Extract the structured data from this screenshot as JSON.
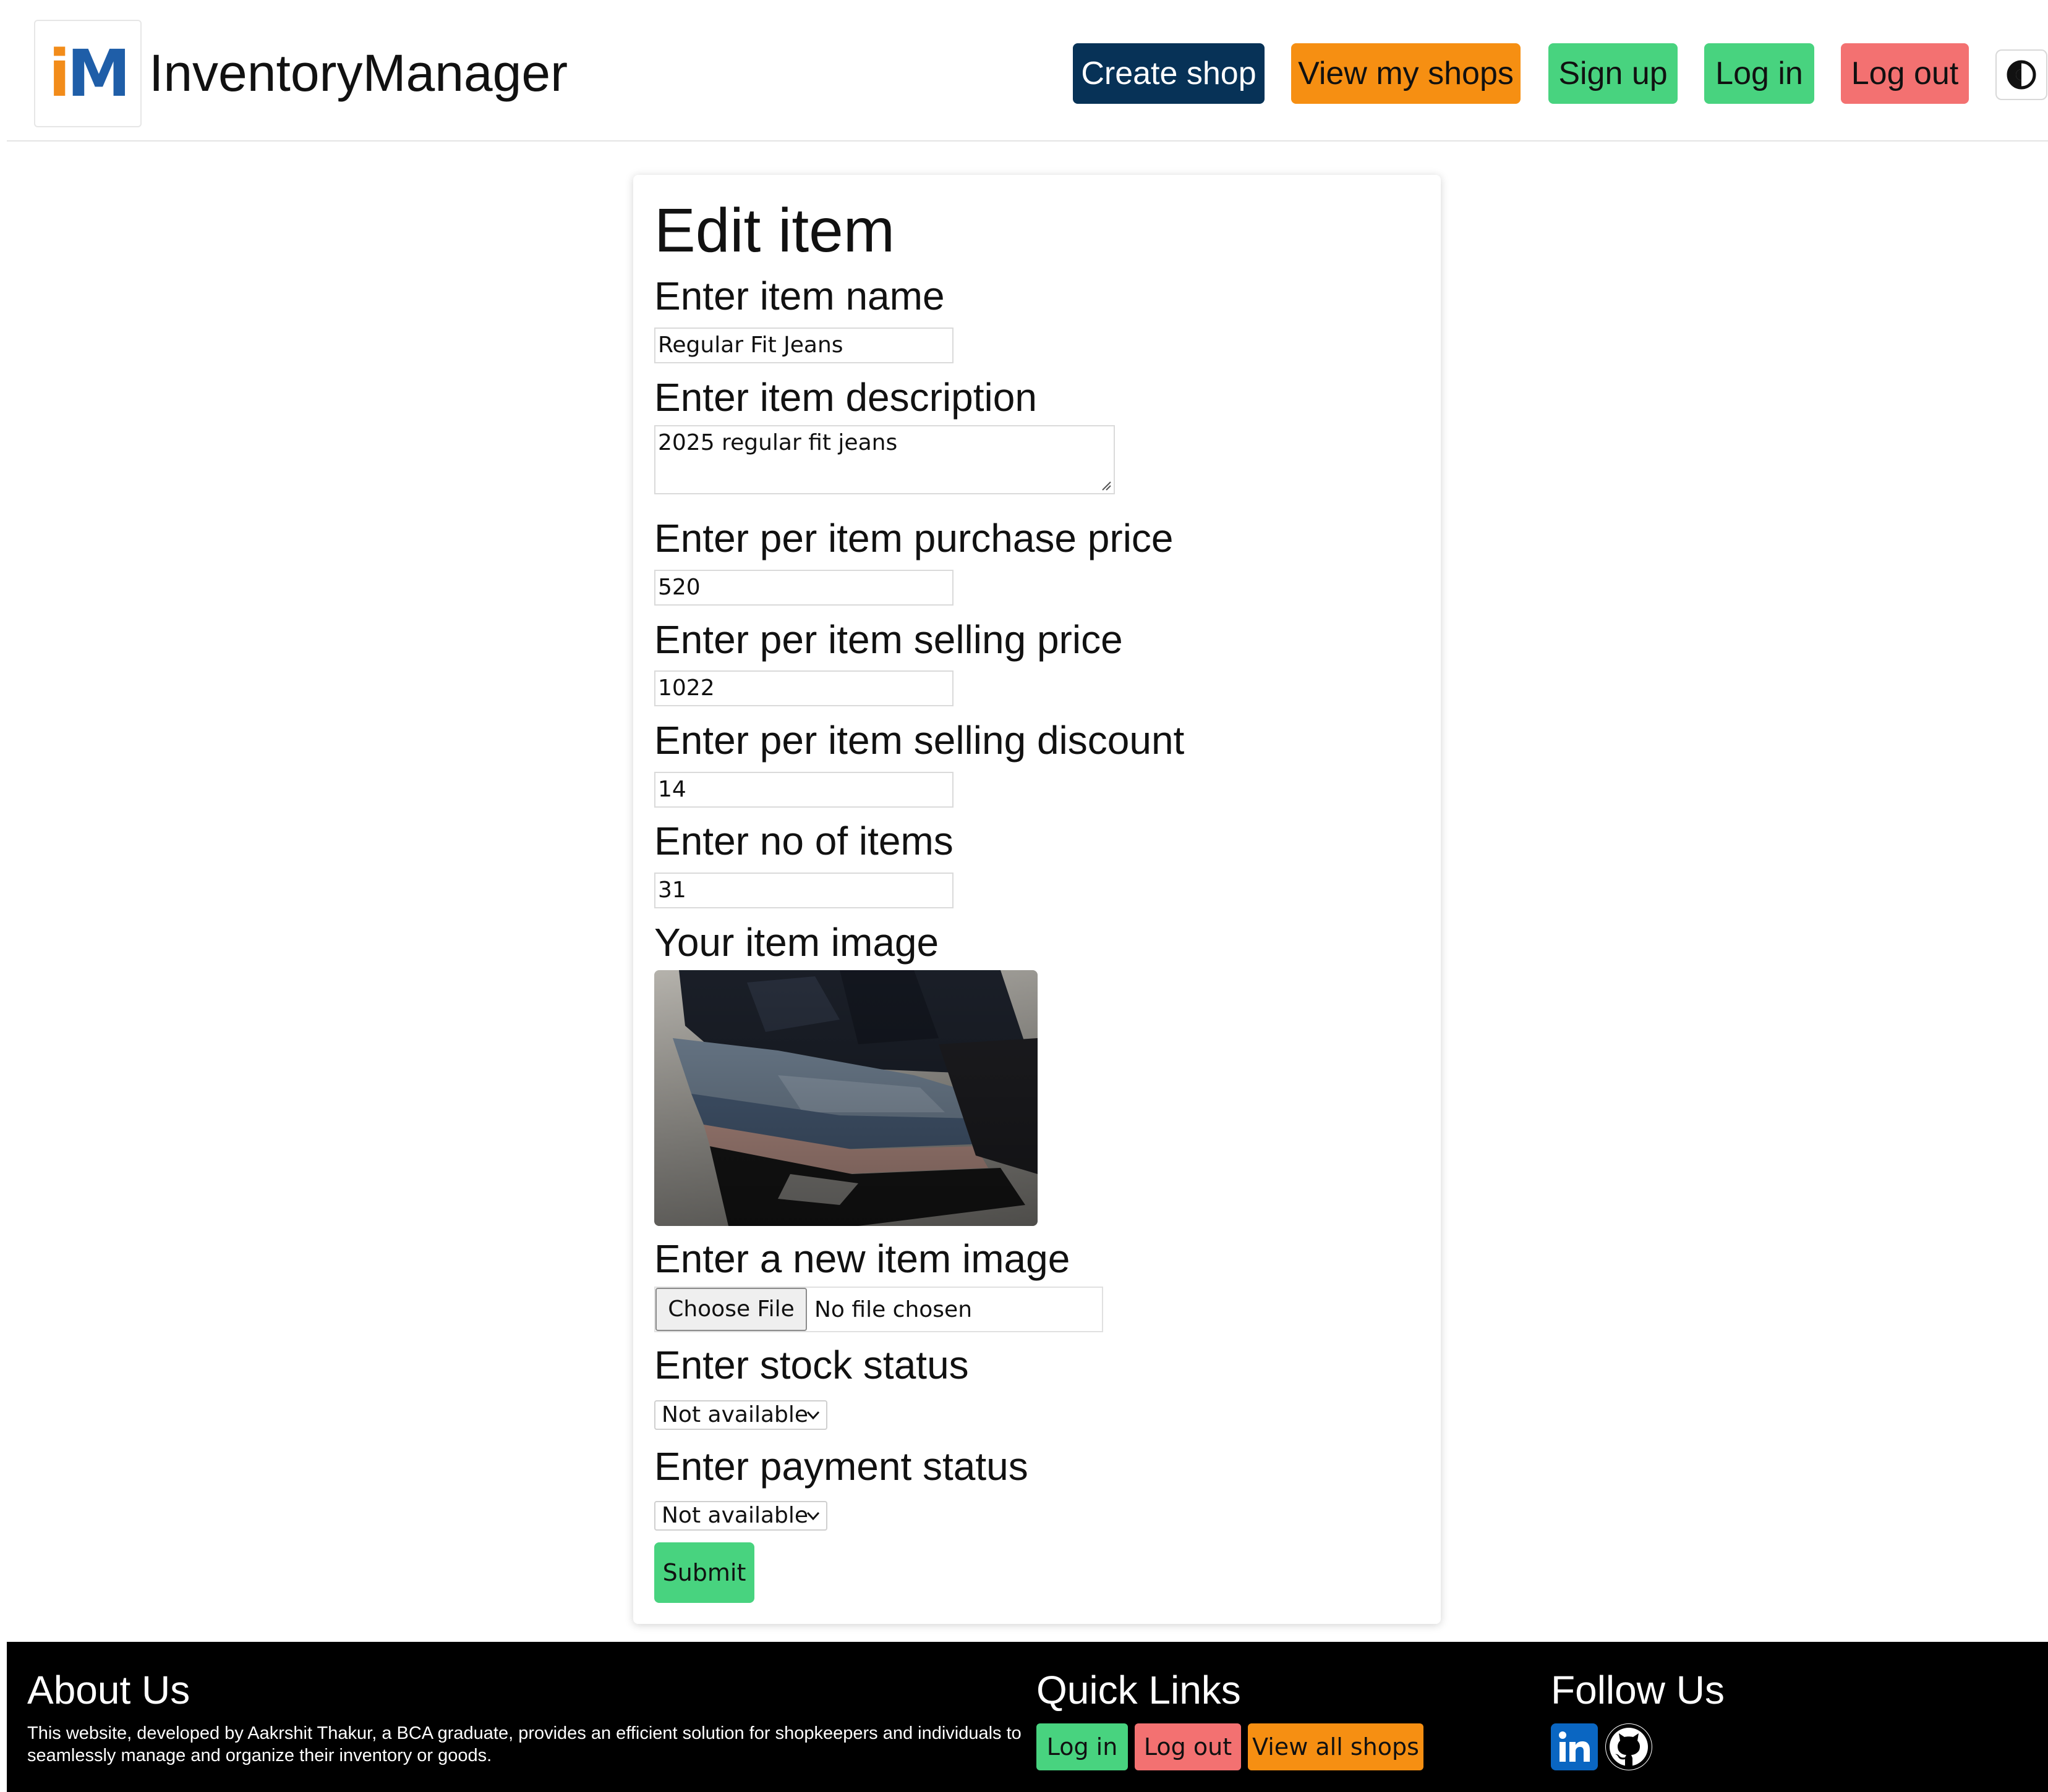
{
  "brand": {
    "logo_i": "i",
    "logo_m": "M",
    "name": "InventoryManager"
  },
  "nav": {
    "create_shop": "Create shop",
    "view_my_shops": "View my shops",
    "sign_up": "Sign up",
    "log_in": "Log in",
    "log_out": "Log out",
    "theme_icon": "contrast-icon"
  },
  "form": {
    "title": "Edit item",
    "name_label": "Enter item name",
    "name_value": "Regular Fit Jeans",
    "description_label": "Enter item description",
    "description_value": "2025 regular fit jeans",
    "purchase_price_label": "Enter per item purchase price",
    "purchase_price_value": "520",
    "selling_price_label": "Enter per item selling price",
    "selling_price_value": "1022",
    "discount_label": "Enter per item selling discount",
    "discount_value": "14",
    "quantity_label": "Enter no of items",
    "quantity_value": "31",
    "image_label": "Your item image",
    "new_image_label": "Enter a new item image",
    "choose_file": "Choose File",
    "no_file": "No file chosen",
    "stock_label": "Enter stock status",
    "stock_value": "Not available",
    "payment_label": "Enter payment status",
    "payment_value": "Not available",
    "submit": "Submit"
  },
  "footer": {
    "about_title": "About Us",
    "about_text": "This website, developed by Aakrshit Thakur, a BCA graduate, provides an efficient solution for shopkeepers and individuals to seamlessly manage and organize their inventory or goods.",
    "links_title": "Quick Links",
    "link_login": "Log in",
    "link_logout": "Log out",
    "link_view_all": "View all shops",
    "follow_title": "Follow Us",
    "social_icons": [
      "linkedin-icon",
      "github-icon"
    ]
  },
  "colors": {
    "dark_blue": "#073257",
    "orange": "#f68f12",
    "green": "#48d37f",
    "red": "#f37171",
    "logo_orange": "#f28c1a",
    "logo_blue": "#1f5ea8",
    "linkedin_blue": "#0a66c2"
  }
}
